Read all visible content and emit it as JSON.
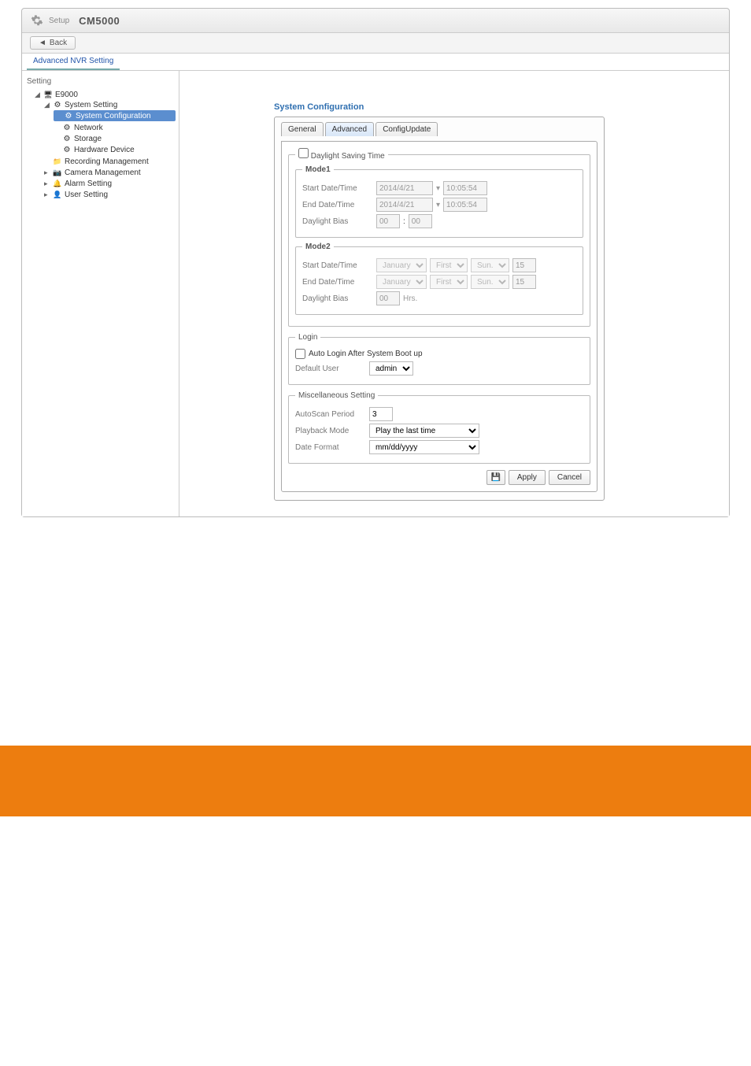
{
  "title_bar": {
    "setup_label": "Setup",
    "app_name": "CM5000"
  },
  "back_button": "Back",
  "top_tab": "Advanced NVR Setting",
  "sidebar": {
    "header": "Setting",
    "root": "E9000",
    "system_setting": "System Setting",
    "system_configuration": "System Configuration",
    "network": "Network",
    "storage": "Storage",
    "hardware_device": "Hardware Device",
    "recording_management": "Recording Management",
    "camera_management": "Camera Management",
    "alarm_setting": "Alarm Setting",
    "user_setting": "User Setting"
  },
  "panel_title": "System Configuration",
  "tabs": {
    "general": "General",
    "advanced": "Advanced",
    "config_update": "ConfigUpdate"
  },
  "dst": {
    "legend": "Daylight Saving Time",
    "mode1": {
      "legend": "Mode1",
      "start_label": "Start Date/Time",
      "start_date": "2014/4/21",
      "start_time": "10:05:54",
      "end_label": "End Date/Time",
      "end_date": "2014/4/21",
      "end_time": "10:05:54",
      "bias_label": "Daylight Bias",
      "bias_h": "00",
      "bias_m": "00"
    },
    "mode2": {
      "legend": "Mode2",
      "start_label": "Start Date/Time",
      "end_label": "End Date/Time",
      "bias_label": "Daylight Bias",
      "month": "January",
      "ordinal": "First",
      "day": "Sun.",
      "hour": "15",
      "bias_h": "00",
      "hrs_label": "Hrs."
    }
  },
  "login": {
    "legend": "Login",
    "auto_login_label": "Auto Login After System Boot up",
    "default_user_label": "Default User",
    "default_user_value": "admin"
  },
  "misc": {
    "legend": "Miscellaneous Setting",
    "autoscan_label": "AutoScan Period",
    "autoscan_value": "3",
    "playback_label": "Playback Mode",
    "playback_value": "Play the last time",
    "dateformat_label": "Date Format",
    "dateformat_value": "mm/dd/yyyy"
  },
  "buttons": {
    "apply": "Apply",
    "cancel": "Cancel"
  }
}
